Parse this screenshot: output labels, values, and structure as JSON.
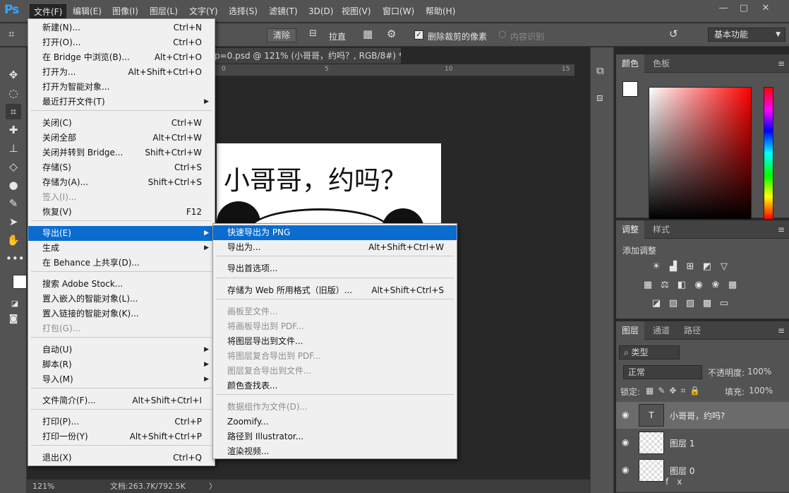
{
  "app": {
    "logo": "Ps"
  },
  "menubar": [
    "文件(F)",
    "编辑(E)",
    "图像(I)",
    "图层(L)",
    "文字(Y)",
    "选择(S)",
    "滤镜(T)",
    "3D(D)",
    "视图(V)",
    "窗口(W)",
    "帮助(H)"
  ],
  "window_controls": [
    "—",
    "▢",
    "✕"
  ],
  "options": {
    "clear_button": "清除",
    "straighten": "拉直",
    "delete_cropped": "删除裁剪的像素",
    "content_aware": "内容识别",
    "workspace": "基本功能"
  },
  "document": {
    "tab_title": "p=0.psd @ 121% (小哥哥，约吗？, RGB/8#) *",
    "image_text": "小哥哥，约吗？",
    "ruler_ticks": [
      "0",
      "5",
      "10",
      "15"
    ],
    "zoom": "121%",
    "doc_size": "文档:263.7K/792.5K"
  },
  "file_menu": [
    {
      "label": "新建(N)...",
      "shortcut": "Ctrl+N"
    },
    {
      "label": "打开(O)...",
      "shortcut": "Ctrl+O"
    },
    {
      "label": "在 Bridge 中浏览(B)...",
      "shortcut": "Alt+Ctrl+O"
    },
    {
      "label": "打开为...",
      "shortcut": "Alt+Shift+Ctrl+O"
    },
    {
      "label": "打开为智能对象...",
      "shortcut": ""
    },
    {
      "label": "最近打开文件(T)",
      "shortcut": "",
      "submenu": true
    },
    {
      "label": "关闭(C)",
      "shortcut": "Ctrl+W"
    },
    {
      "label": "关闭全部",
      "shortcut": "Alt+Ctrl+W"
    },
    {
      "label": "关闭并转到 Bridge...",
      "shortcut": "Shift+Ctrl+W"
    },
    {
      "label": "存储(S)",
      "shortcut": "Ctrl+S"
    },
    {
      "label": "存储为(A)...",
      "shortcut": "Shift+Ctrl+S"
    },
    {
      "label": "签入(I)...",
      "shortcut": "",
      "disabled": true
    },
    {
      "label": "恢复(V)",
      "shortcut": "F12"
    },
    {
      "label": "导出(E)",
      "shortcut": "",
      "submenu": true,
      "highlight": true
    },
    {
      "label": "生成",
      "shortcut": "",
      "submenu": true
    },
    {
      "label": "在 Behance 上共享(D)...",
      "shortcut": ""
    },
    {
      "label": "搜索 Adobe Stock...",
      "shortcut": ""
    },
    {
      "label": "置入嵌入的智能对象(L)...",
      "shortcut": ""
    },
    {
      "label": "置入链接的智能对象(K)...",
      "shortcut": ""
    },
    {
      "label": "打包(G)...",
      "shortcut": "",
      "disabled": true
    },
    {
      "label": "自动(U)",
      "shortcut": "",
      "submenu": true
    },
    {
      "label": "脚本(R)",
      "shortcut": "",
      "submenu": true
    },
    {
      "label": "导入(M)",
      "shortcut": "",
      "submenu": true
    },
    {
      "label": "文件简介(F)...",
      "shortcut": "Alt+Shift+Ctrl+I"
    },
    {
      "label": "打印(P)...",
      "shortcut": "Ctrl+P"
    },
    {
      "label": "打印一份(Y)",
      "shortcut": "Alt+Shift+Ctrl+P"
    },
    {
      "label": "退出(X)",
      "shortcut": "Ctrl+Q"
    }
  ],
  "export_menu": [
    {
      "label": "快速导出为 PNG",
      "shortcut": "",
      "highlight": true
    },
    {
      "label": "导出为...",
      "shortcut": "Alt+Shift+Ctrl+W"
    },
    {
      "label": "导出首选项...",
      "shortcut": ""
    },
    {
      "label": "存储为 Web 所用格式（旧版）...",
      "shortcut": "Alt+Shift+Ctrl+S"
    },
    {
      "label": "画板至文件...",
      "shortcut": "",
      "disabled": true
    },
    {
      "label": "将画板导出到 PDF...",
      "shortcut": "",
      "disabled": true
    },
    {
      "label": "将图层导出到文件...",
      "shortcut": ""
    },
    {
      "label": "将图层复合导出到 PDF...",
      "shortcut": "",
      "disabled": true
    },
    {
      "label": "图层复合导出到文件...",
      "shortcut": "",
      "disabled": true
    },
    {
      "label": "颜色查找表...",
      "shortcut": ""
    },
    {
      "label": "数据组作为文件(D)...",
      "shortcut": "",
      "disabled": true
    },
    {
      "label": "Zoomify...",
      "shortcut": ""
    },
    {
      "label": "路径到 Illustrator...",
      "shortcut": ""
    },
    {
      "label": "渲染视频...",
      "shortcut": ""
    }
  ],
  "panels": {
    "color_tabs": [
      "颜色",
      "色板"
    ],
    "adjust_tabs": [
      "调整",
      "样式"
    ],
    "adjust_label": "添加调整",
    "layers_tabs": [
      "图层",
      "通道",
      "路径"
    ],
    "kind_filter": "类型",
    "blend_mode": "正常",
    "opacity_label": "不透明度:",
    "opacity_value": "100%",
    "lock_label": "锁定:",
    "fill_label": "填充:",
    "fill_value": "100%",
    "layers": [
      "小哥哥，约吗?",
      "图层 1",
      "图层 0"
    ],
    "bottom_icons": "fx"
  },
  "colors": {
    "highlight": "#0a6ccf",
    "ps_blue": "#31a8ff"
  }
}
